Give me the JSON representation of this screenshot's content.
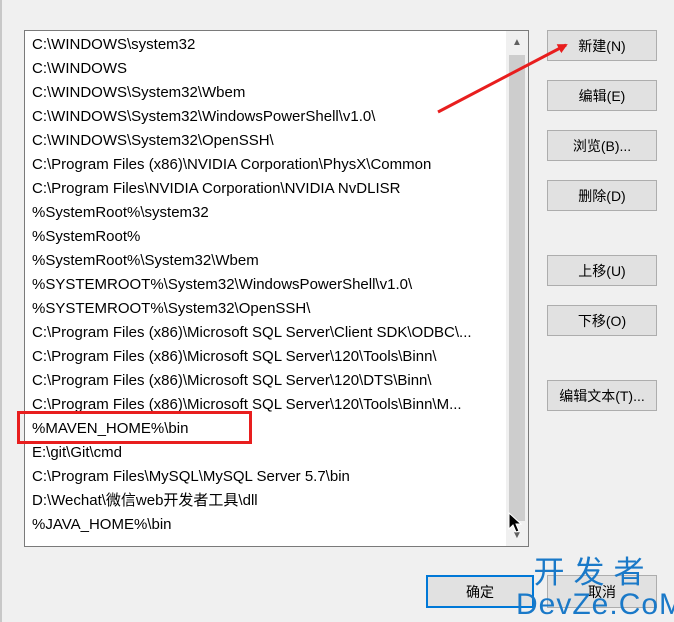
{
  "path_list": {
    "entries": [
      "C:\\WINDOWS\\system32",
      "C:\\WINDOWS",
      "C:\\WINDOWS\\System32\\Wbem",
      "C:\\WINDOWS\\System32\\WindowsPowerShell\\v1.0\\",
      "C:\\WINDOWS\\System32\\OpenSSH\\",
      "C:\\Program Files (x86)\\NVIDIA Corporation\\PhysX\\Common",
      "C:\\Program Files\\NVIDIA Corporation\\NVIDIA NvDLISR",
      "%SystemRoot%\\system32",
      "%SystemRoot%",
      "%SystemRoot%\\System32\\Wbem",
      "%SYSTEMROOT%\\System32\\WindowsPowerShell\\v1.0\\",
      "%SYSTEMROOT%\\System32\\OpenSSH\\",
      "C:\\Program Files (x86)\\Microsoft SQL Server\\Client SDK\\ODBC\\...",
      "C:\\Program Files (x86)\\Microsoft SQL Server\\120\\Tools\\Binn\\",
      "C:\\Program Files (x86)\\Microsoft SQL Server\\120\\DTS\\Binn\\",
      "C:\\Program Files (x86)\\Microsoft SQL Server\\120\\Tools\\Binn\\M...",
      "%MAVEN_HOME%\\bin",
      "E:\\git\\Git\\cmd",
      "C:\\Program Files\\MySQL\\MySQL Server 5.7\\bin",
      "D:\\Wechat\\微信web开发者工具\\dll",
      "%JAVA_HOME%\\bin"
    ]
  },
  "buttons": {
    "new": "新建(N)",
    "edit": "编辑(E)",
    "browse": "浏览(B)...",
    "delete": "删除(D)",
    "move_up": "上移(U)",
    "move_down": "下移(O)",
    "edit_text": "编辑文本(T)...",
    "ok": "确定",
    "cancel": "取消"
  },
  "watermark": {
    "chinese": "开发者",
    "latin": "DevZe.CoM"
  },
  "annotation": {
    "arrow_color": "#e81e1e",
    "box_color": "#e81e1e"
  }
}
